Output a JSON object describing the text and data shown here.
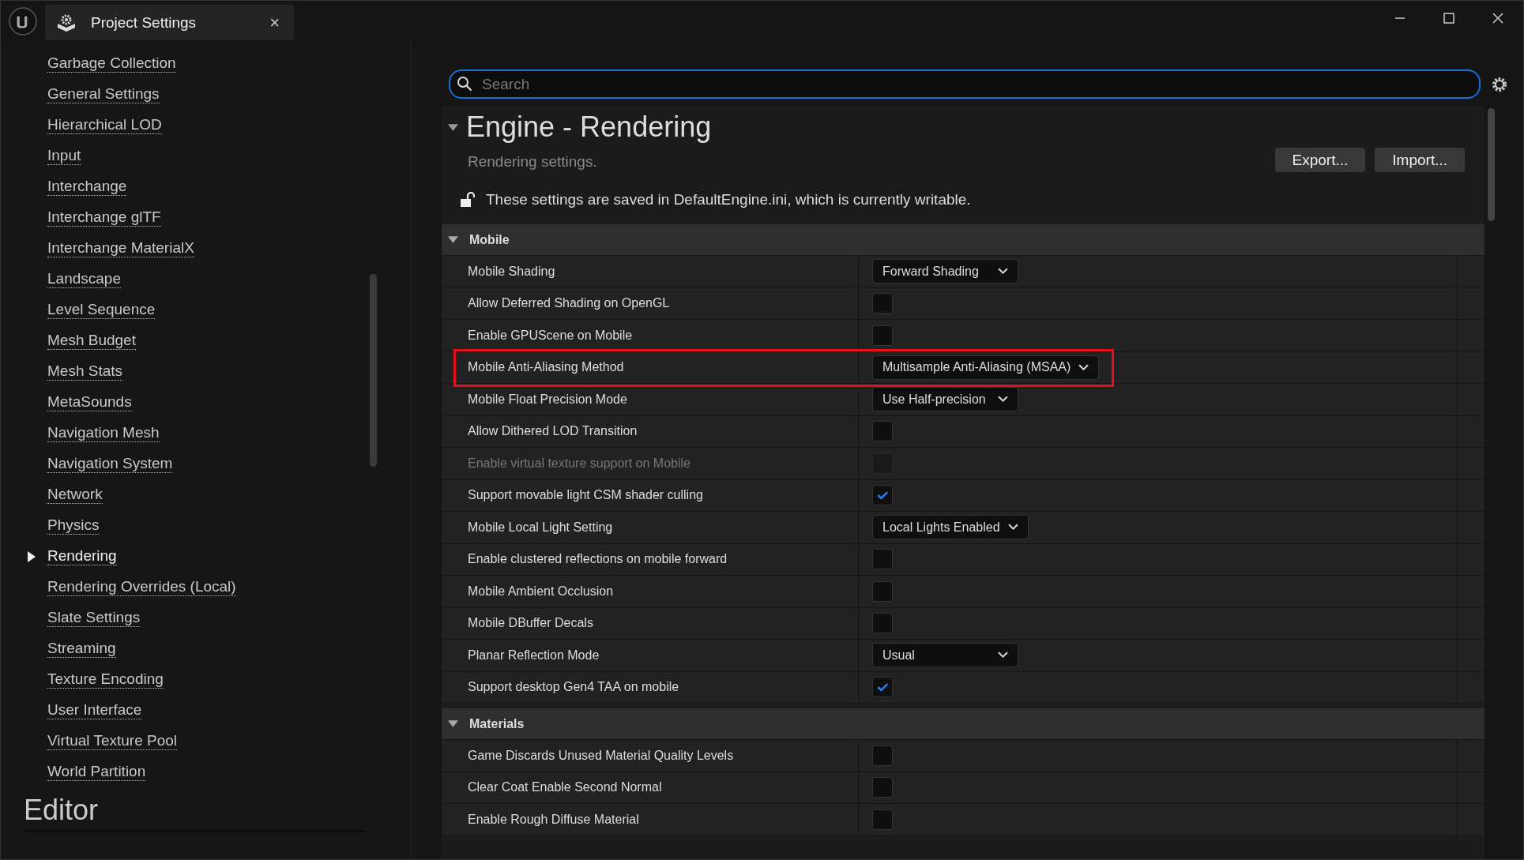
{
  "tab": {
    "title": "Project Settings",
    "close": "×"
  },
  "sidebar": {
    "items": [
      {
        "label": "Garbage Collection",
        "selected": false
      },
      {
        "label": "General Settings",
        "selected": false
      },
      {
        "label": "Hierarchical LOD",
        "selected": false
      },
      {
        "label": "Input",
        "selected": false
      },
      {
        "label": "Interchange",
        "selected": false
      },
      {
        "label": "Interchange glTF",
        "selected": false
      },
      {
        "label": "Interchange MaterialX",
        "selected": false
      },
      {
        "label": "Landscape",
        "selected": false
      },
      {
        "label": "Level Sequence",
        "selected": false
      },
      {
        "label": "Mesh Budget",
        "selected": false
      },
      {
        "label": "Mesh Stats",
        "selected": false
      },
      {
        "label": "MetaSounds",
        "selected": false
      },
      {
        "label": "Navigation Mesh",
        "selected": false
      },
      {
        "label": "Navigation System",
        "selected": false
      },
      {
        "label": "Network",
        "selected": false
      },
      {
        "label": "Physics",
        "selected": false
      },
      {
        "label": "Rendering",
        "selected": true
      },
      {
        "label": "Rendering Overrides (Local)",
        "selected": false
      },
      {
        "label": "Slate Settings",
        "selected": false
      },
      {
        "label": "Streaming",
        "selected": false
      },
      {
        "label": "Texture Encoding",
        "selected": false
      },
      {
        "label": "User Interface",
        "selected": false
      },
      {
        "label": "Virtual Texture Pool",
        "selected": false
      },
      {
        "label": "World Partition",
        "selected": false
      }
    ],
    "heading": "Editor"
  },
  "search": {
    "placeholder": "Search"
  },
  "header": {
    "title": "Engine - Rendering",
    "subtitle": "Rendering settings.",
    "buttons": [
      "Export...",
      "Import..."
    ],
    "notice": "These settings are saved in DefaultEngine.ini, which is currently writable."
  },
  "sections": [
    {
      "title": "Mobile",
      "expanded": true,
      "rows": [
        {
          "label": "Mobile Shading",
          "kind": "dropdown",
          "value": "Forward Shading"
        },
        {
          "label": "Allow Deferred Shading on OpenGL",
          "kind": "checkbox",
          "checked": false,
          "disabled": false
        },
        {
          "label": "Enable GPUScene on Mobile",
          "kind": "checkbox",
          "checked": false,
          "disabled": false
        },
        {
          "label": "Mobile Anti-Aliasing Method",
          "kind": "dropdown",
          "value": "Multisample Anti-Aliasing (MSAA)",
          "highlighted": true
        },
        {
          "label": "Mobile Float Precision Mode",
          "kind": "dropdown",
          "value": "Use Half-precision"
        },
        {
          "label": "Allow Dithered LOD Transition",
          "kind": "checkbox",
          "checked": false,
          "disabled": false
        },
        {
          "label": "Enable virtual texture support on Mobile",
          "kind": "checkbox",
          "checked": false,
          "disabled": true
        },
        {
          "label": "Support movable light CSM shader culling",
          "kind": "checkbox",
          "checked": true,
          "disabled": false
        },
        {
          "label": "Mobile Local Light Setting",
          "kind": "dropdown",
          "value": "Local Lights Enabled"
        },
        {
          "label": "Enable clustered reflections on mobile forward",
          "kind": "checkbox",
          "checked": false,
          "disabled": false
        },
        {
          "label": "Mobile Ambient Occlusion",
          "kind": "checkbox",
          "checked": false,
          "disabled": false
        },
        {
          "label": "Mobile DBuffer Decals",
          "kind": "checkbox",
          "checked": false,
          "disabled": false
        },
        {
          "label": "Planar Reflection Mode",
          "kind": "dropdown",
          "value": "Usual"
        },
        {
          "label": "Support desktop Gen4 TAA on mobile",
          "kind": "checkbox",
          "checked": true,
          "disabled": false
        }
      ]
    },
    {
      "title": "Materials",
      "expanded": true,
      "rows": [
        {
          "label": "Game Discards Unused Material Quality Levels",
          "kind": "checkbox",
          "checked": false,
          "disabled": false
        },
        {
          "label": "Clear Coat Enable Second Normal",
          "kind": "checkbox",
          "checked": false,
          "disabled": false
        },
        {
          "label": "Enable Rough Diffuse Material",
          "kind": "checkbox",
          "checked": false,
          "disabled": false
        }
      ]
    }
  ]
}
